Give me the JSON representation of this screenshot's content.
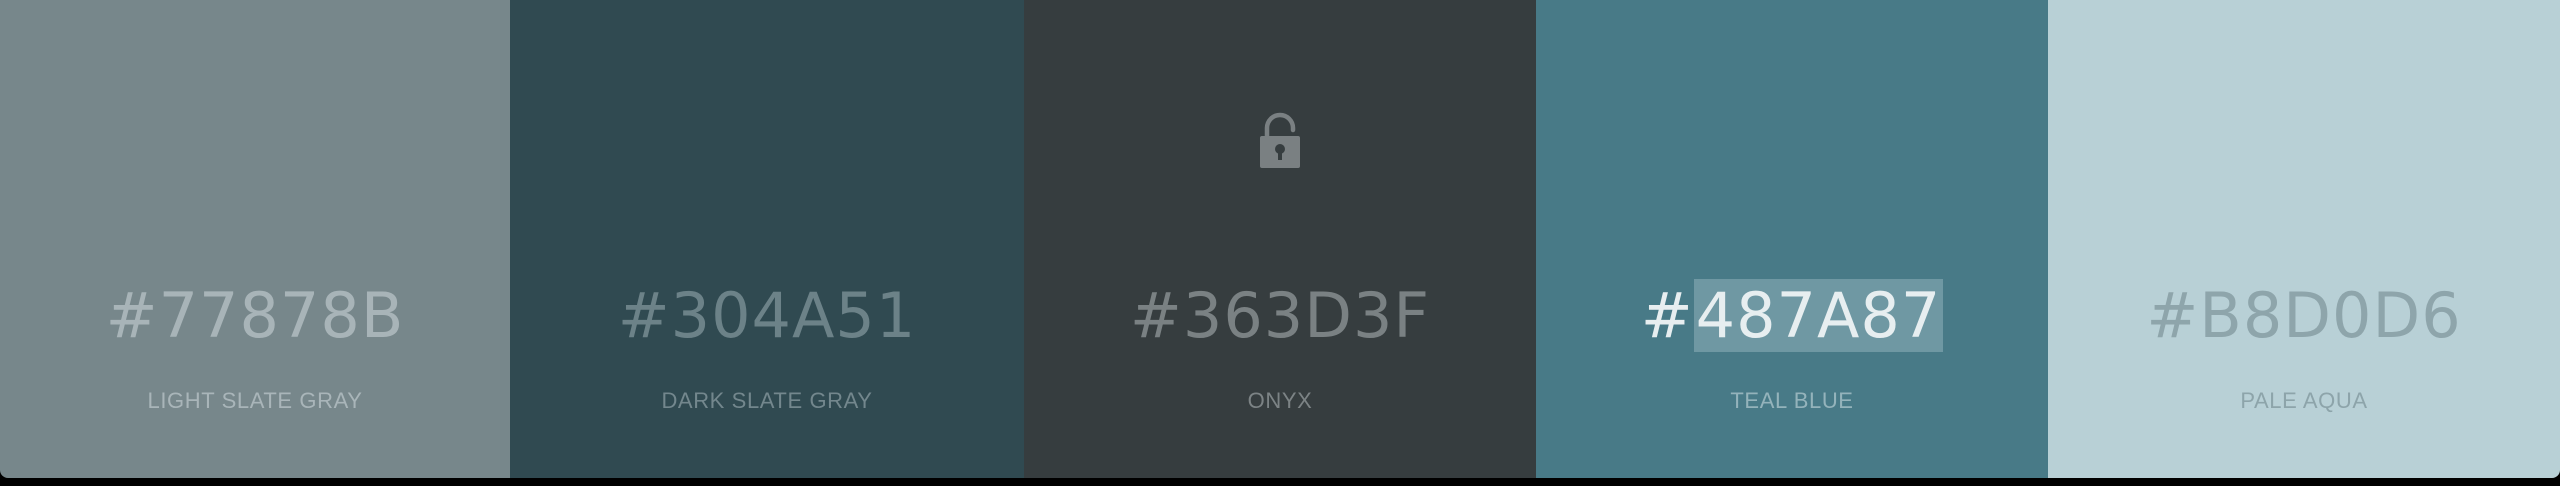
{
  "swatches": [
    {
      "hex": "#77878B",
      "name": "LIGHT SLATE GRAY",
      "bg": "#77878B",
      "hex_color": "#A8B4B8",
      "name_color": "#A9B5B9"
    },
    {
      "hex": "#304A51",
      "name": "DARK SLATE GRAY",
      "bg": "#304A51",
      "hex_color": "#6C8288",
      "name_color": "#73878D"
    },
    {
      "hex": "#363D3F",
      "name": "ONYX",
      "bg": "#363D3F",
      "hex_color": "#7A8183",
      "name_color": "#7C8385",
      "lock_icon": "unlock-icon",
      "lock_color": "#7A8082"
    },
    {
      "hex_prefix": "#",
      "hex_selected": "487A87",
      "hex": "#487A87",
      "name": "TEAL BLUE",
      "bg": "#487A87",
      "hex_color": "#E7EEF0",
      "name_color": "#94B3BB",
      "selection_color": "#6F98A3"
    },
    {
      "hex": "#B8D0D6",
      "name": "PALE AQUA",
      "bg": "#B8D0D6",
      "hex_color": "#8EA5AB",
      "name_color": "#8DA4AA"
    }
  ]
}
